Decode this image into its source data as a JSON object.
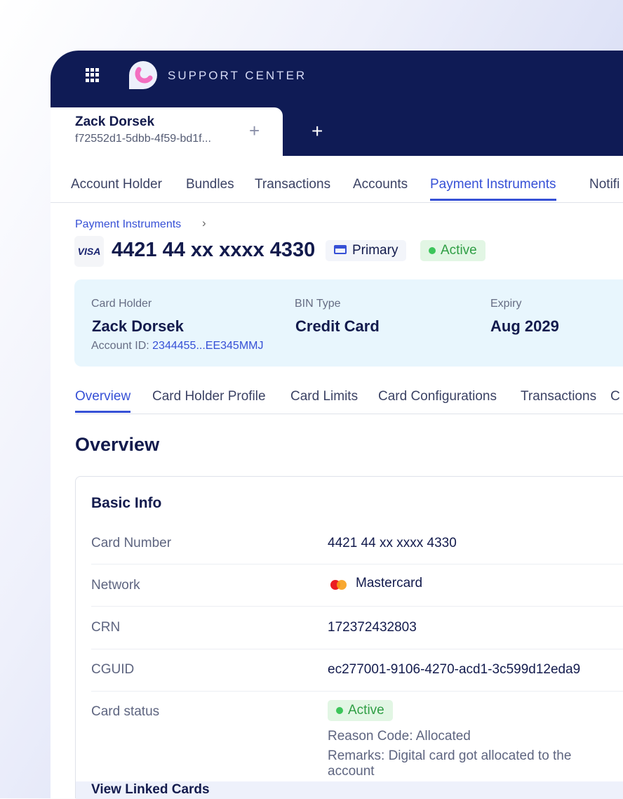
{
  "header": {
    "brand": "SUPPORT CENTER"
  },
  "session_tab": {
    "name": "Zack Dorsek",
    "id": "f72552d1-5dbb-4f59-bd1f..."
  },
  "nav": {
    "items": [
      "Account Holder",
      "Bundles",
      "Transactions",
      "Accounts",
      "Payment Instruments",
      "Notifi"
    ],
    "active": "Payment Instruments"
  },
  "breadcrumb": {
    "label": "Payment Instruments"
  },
  "card": {
    "brand": "VISA",
    "number": "4421 44 xx xxxx 4330",
    "primary_label": "Primary",
    "status": "Active"
  },
  "summary": {
    "holder_label": "Card Holder",
    "holder": "Zack Dorsek",
    "account_id_label": "Account ID:",
    "account_id": "2344455...EE345MMJ",
    "bin_label": "BIN Type",
    "bin": "Credit Card",
    "expiry_label": "Expiry",
    "expiry": "Aug 2029"
  },
  "subtabs": {
    "items": [
      "Overview",
      "Card Holder Profile",
      "Card Limits",
      "Card Configurations",
      "Transactions",
      "C"
    ],
    "active": "Overview"
  },
  "section_title": "Overview",
  "basic_info": {
    "title": "Basic Info",
    "rows": [
      {
        "label": "Card Number",
        "value": "4421 44 xx xxxx 4330"
      },
      {
        "label": "Network",
        "value": "Mastercard"
      },
      {
        "label": "CRN",
        "value": "172372432803"
      },
      {
        "label": "CGUID",
        "value": "ec277001-9106-4270-acd1-3c599d12eda9"
      },
      {
        "label": "Card status",
        "value": "Active"
      }
    ],
    "reason": "Reason Code: Allocated",
    "remarks": "Remarks: Digital card got allocated to the account",
    "footer_link": "View Linked Cards"
  },
  "colors": {
    "navy": "#0f1b55",
    "accent": "#3650d6",
    "active_green": "#2f9e44",
    "info_bg": "#e8f6fd"
  }
}
